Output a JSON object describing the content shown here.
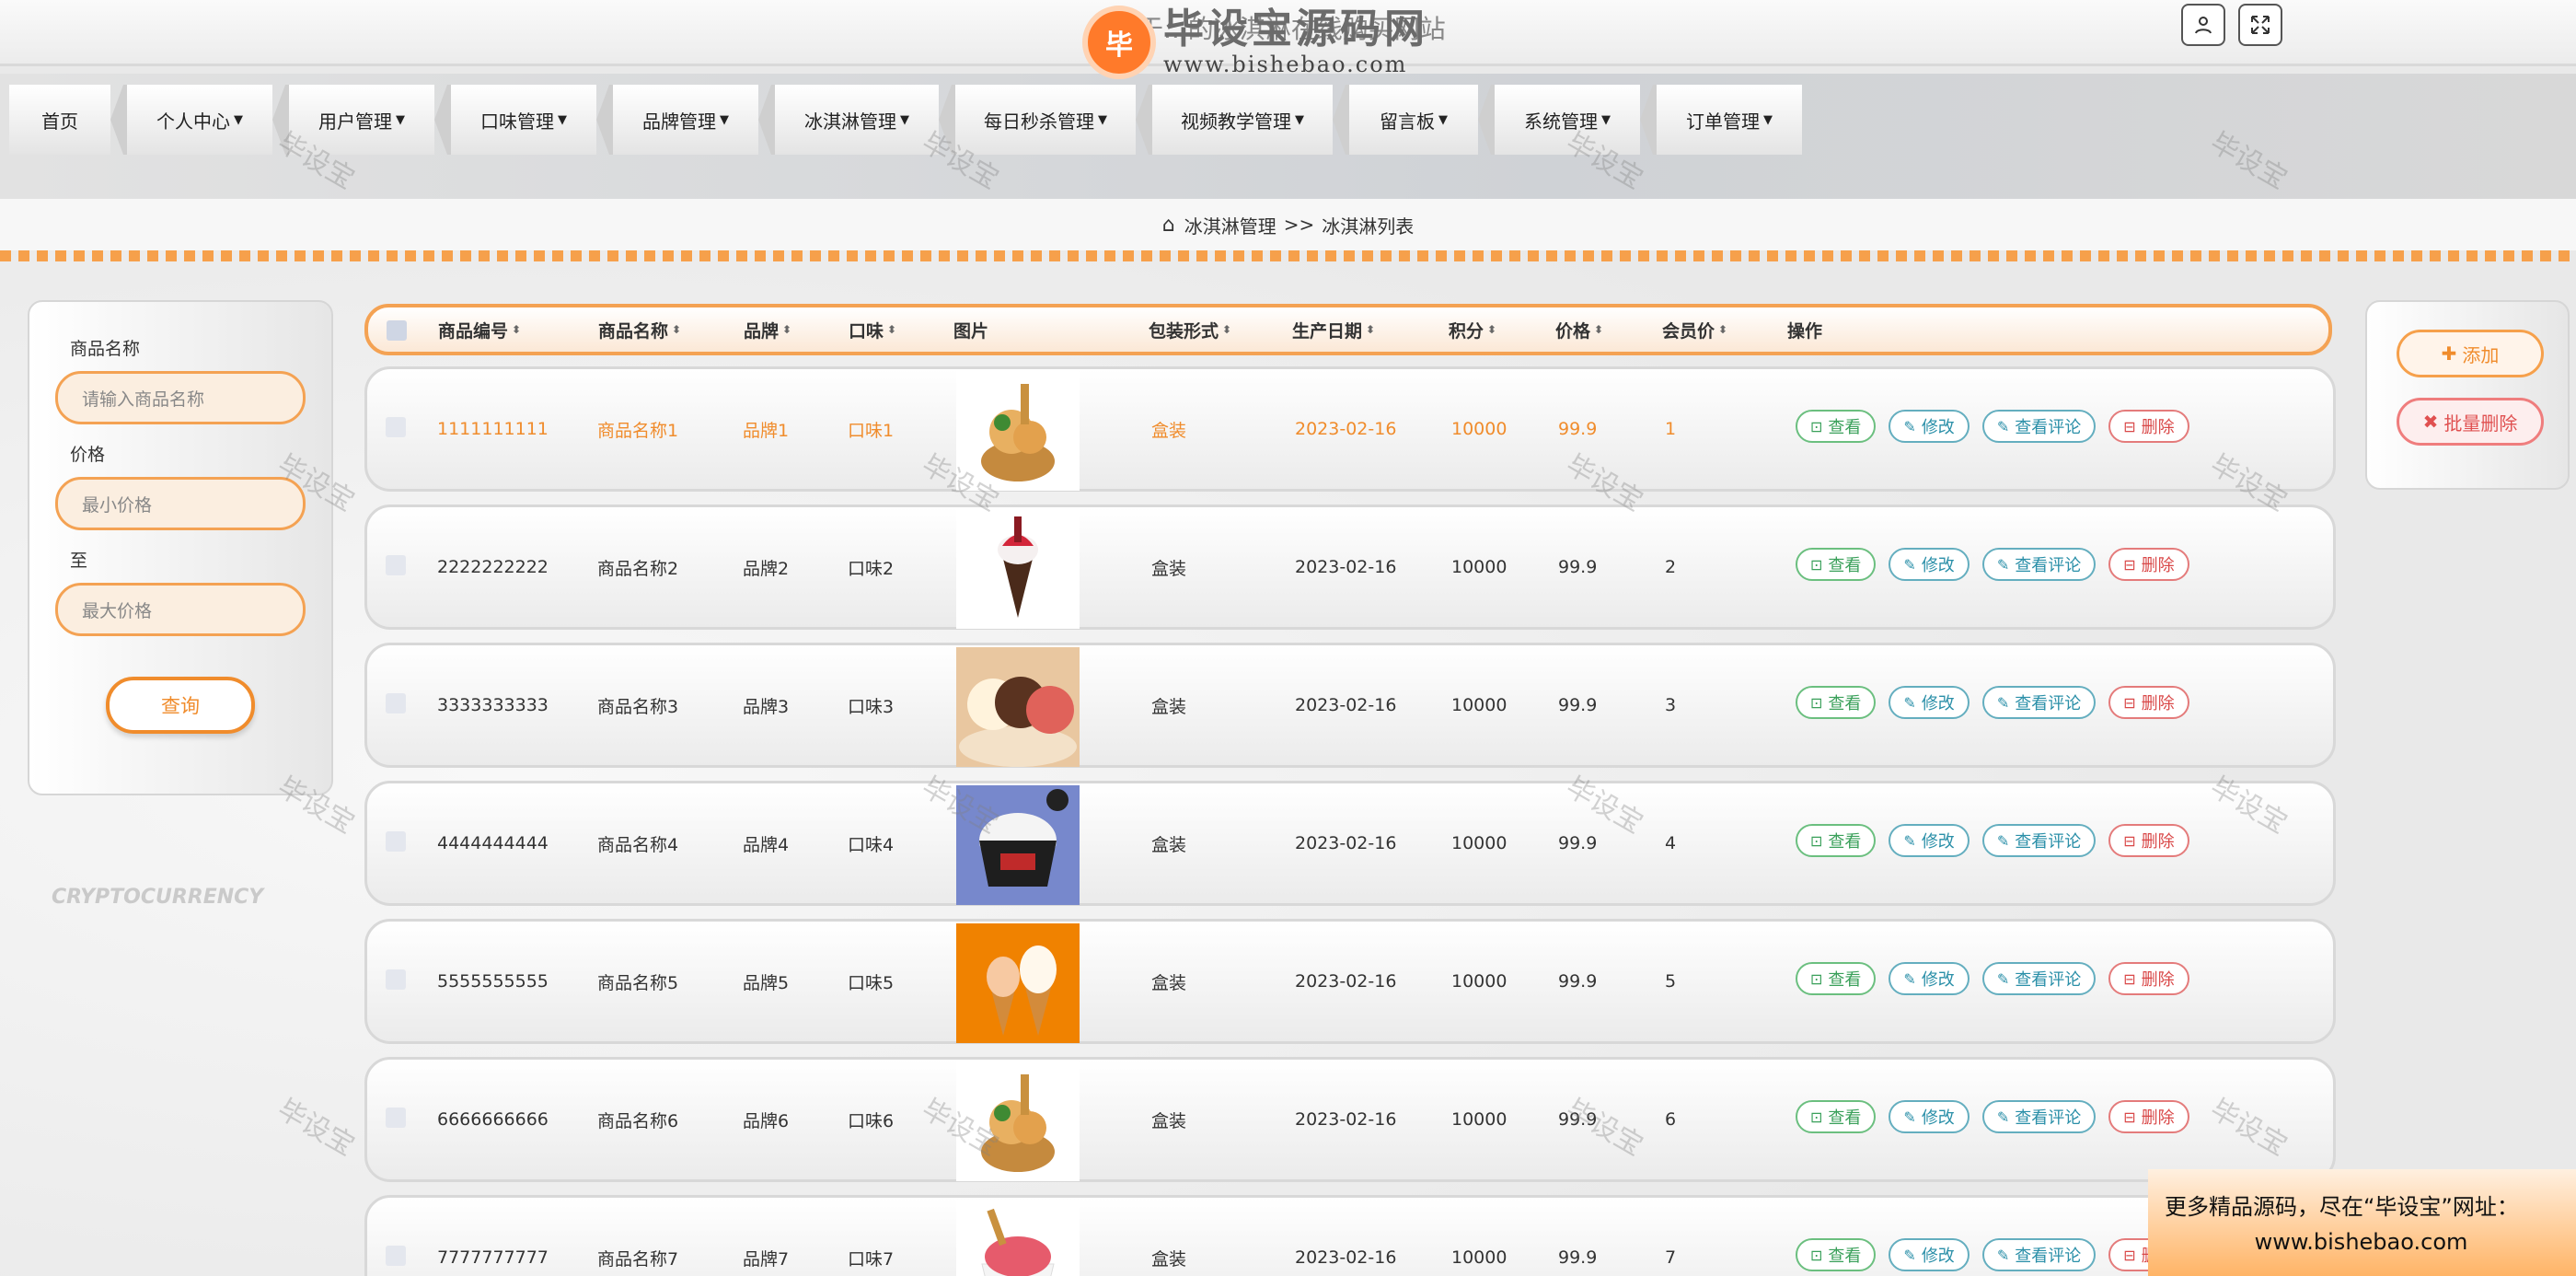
{
  "header": {
    "site_title": "基于...的冰淇淋在线购买网站",
    "logo_text": "毕设宝源码网",
    "logo_url": "www.bishebao.com",
    "logo_badge": "毕",
    "user_icon": "user-icon",
    "fullscreen_icon": "fullscreen-icon"
  },
  "nav": {
    "items": [
      {
        "label": "首页"
      },
      {
        "label": "个人中心"
      },
      {
        "label": "用户管理"
      },
      {
        "label": "口味管理"
      },
      {
        "label": "品牌管理"
      },
      {
        "label": "冰淇淋管理"
      },
      {
        "label": "每日秒杀管理"
      },
      {
        "label": "视频教学管理"
      },
      {
        "label": "留言板"
      },
      {
        "label": "系统管理"
      },
      {
        "label": "订单管理"
      }
    ]
  },
  "breadcrumb": {
    "level1": "冰淇淋管理",
    "sep": ">>",
    "level2": "冰淇淋列表"
  },
  "search": {
    "name_label": "商品名称",
    "name_placeholder": "请输入商品名称",
    "price_label": "价格",
    "min_placeholder": "最小价格",
    "to_label": "至",
    "max_placeholder": "最大价格",
    "query_button": "查询"
  },
  "actions": {
    "add_label": "添加",
    "batch_delete_label": "批量删除"
  },
  "table": {
    "headers": [
      "商品编号",
      "商品名称",
      "品牌",
      "口味",
      "图片",
      "包装形式",
      "生产日期",
      "积分",
      "价格",
      "会员价",
      "操作"
    ],
    "rows": [
      {
        "code": "1111111111",
        "name": "商品名称1",
        "brand": "品牌1",
        "flavor": "口味1",
        "pack": "盒装",
        "date": "2023-02-16",
        "points": "10000",
        "price": "99.9",
        "member": "1"
      },
      {
        "code": "2222222222",
        "name": "商品名称2",
        "brand": "品牌2",
        "flavor": "口味2",
        "pack": "盒装",
        "date": "2023-02-16",
        "points": "10000",
        "price": "99.9",
        "member": "2"
      },
      {
        "code": "3333333333",
        "name": "商品名称3",
        "brand": "品牌3",
        "flavor": "口味3",
        "pack": "盒装",
        "date": "2023-02-16",
        "points": "10000",
        "price": "99.9",
        "member": "3"
      },
      {
        "code": "4444444444",
        "name": "商品名称4",
        "brand": "品牌4",
        "flavor": "口味4",
        "pack": "盒装",
        "date": "2023-02-16",
        "points": "10000",
        "price": "99.9",
        "member": "4"
      },
      {
        "code": "5555555555",
        "name": "商品名称5",
        "brand": "品牌5",
        "flavor": "口味5",
        "pack": "盒装",
        "date": "2023-02-16",
        "points": "10000",
        "price": "99.9",
        "member": "5"
      },
      {
        "code": "6666666666",
        "name": "商品名称6",
        "brand": "品牌6",
        "flavor": "口味6",
        "pack": "盒装",
        "date": "2023-02-16",
        "points": "10000",
        "price": "99.9",
        "member": "6"
      },
      {
        "code": "7777777777",
        "name": "商品名称7",
        "brand": "品牌7",
        "flavor": "口味7",
        "pack": "盒装",
        "date": "2023-02-16",
        "points": "10000",
        "price": "99.9",
        "member": "7"
      }
    ],
    "ops": {
      "view": "查看",
      "edit": "修改",
      "comments": "查看评论",
      "delete": "删除"
    }
  },
  "watermark": "毕设宝",
  "bg_text": "CRYPTOCURRENCY",
  "promo": {
    "line1": "更多精品源码，尽在“毕设宝”网址：",
    "line2": "www.bishebao.com"
  },
  "colors": {
    "accent": "#f08c2c",
    "view": "#3aa05a",
    "edit": "#2a8fa8",
    "delete": "#d94848"
  }
}
